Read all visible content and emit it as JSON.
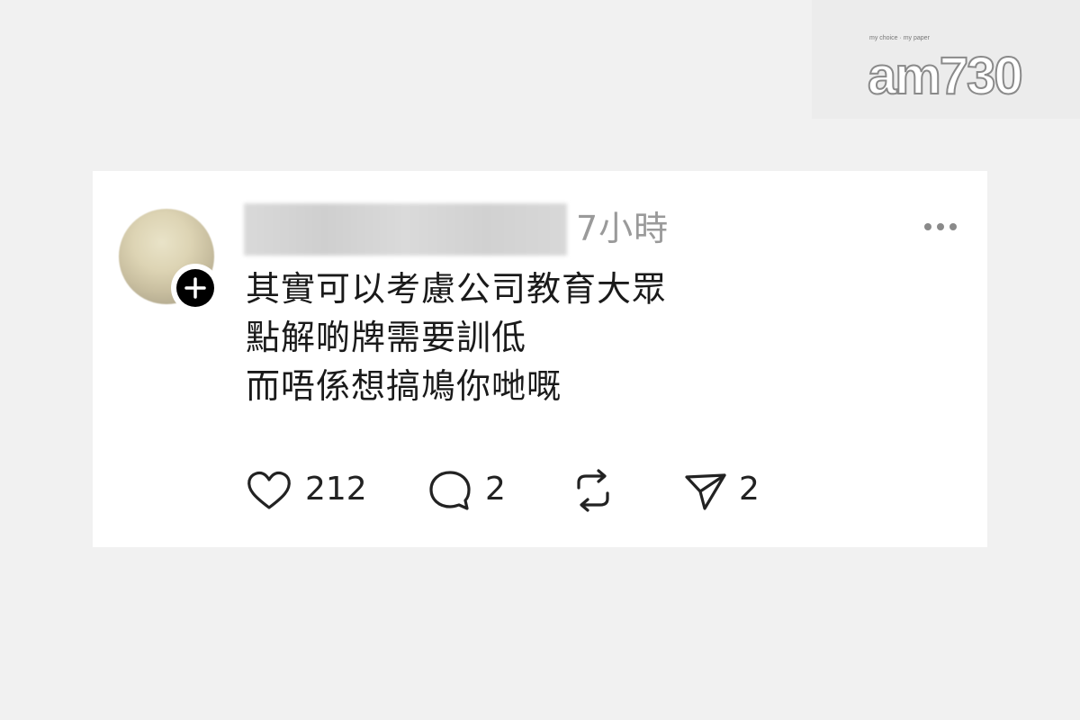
{
  "watermark": {
    "logo_text_main": "am730",
    "logo_tagline": "my choice · my paper"
  },
  "post": {
    "timestamp": "7小時",
    "lines": [
      "其實可以考慮公司教育大眾",
      "點解啲牌需要訓低",
      "而唔係想搞鳩你哋嘅"
    ],
    "actions": {
      "like_count": "212",
      "reply_count": "2",
      "repost_count": "",
      "share_count": "2"
    }
  },
  "icons": {
    "follow": "plus-icon",
    "more": "more-dots-icon",
    "like": "heart-icon",
    "reply": "comment-bubble-icon",
    "repost": "repost-icon",
    "share": "send-icon"
  },
  "colors": {
    "background": "#f1f1f1",
    "card": "#ffffff",
    "text": "#1a1a1a",
    "muted": "#9a9a9a"
  }
}
